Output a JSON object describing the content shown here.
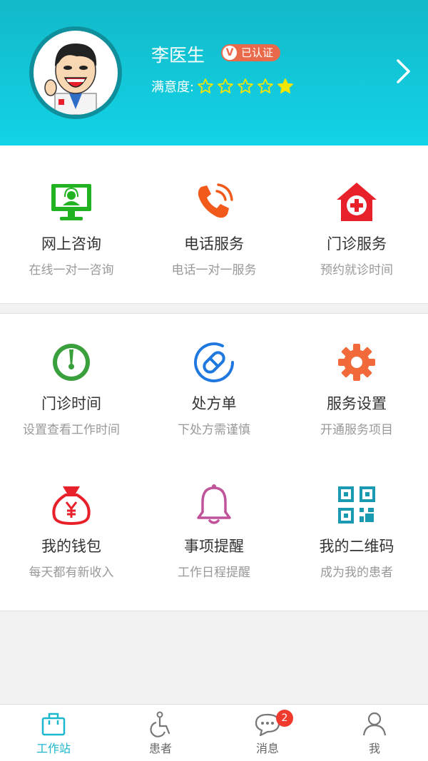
{
  "profile": {
    "name": "李医生",
    "badge_letter": "V",
    "badge_text": "已认证",
    "satisfaction_label": "满意度:",
    "rating": 1,
    "rating_max": 5
  },
  "services": [
    {
      "title": "网上咨询",
      "subtitle": "在线一对一咨询",
      "icon": "monitor-headset-icon",
      "color": "#22b322"
    },
    {
      "title": "电话服务",
      "subtitle": "电话一对一服务",
      "icon": "phone-call-icon",
      "color": "#f25a1b"
    },
    {
      "title": "门诊服务",
      "subtitle": "预约就诊时间",
      "icon": "hospital-icon",
      "color": "#e8202a"
    }
  ],
  "tools": [
    {
      "title": "门诊时间",
      "subtitle": "设置查看工作时间",
      "icon": "clock-icon",
      "color": "#3aa03d"
    },
    {
      "title": "处方单",
      "subtitle": "下处方需谨慎",
      "icon": "pill-icon",
      "color": "#1f78e0"
    },
    {
      "title": "服务设置",
      "subtitle": "开通服务项目",
      "icon": "gear-icon",
      "color": "#f26a3a"
    },
    {
      "title": "我的钱包",
      "subtitle": "每天都有新收入",
      "icon": "money-bag-icon",
      "color": "#e8202a"
    },
    {
      "title": "事项提醒",
      "subtitle": "工作日程提醒",
      "icon": "bell-icon",
      "color": "#c0539a"
    },
    {
      "title": "我的二维码",
      "subtitle": "成为我的患者",
      "icon": "qr-code-icon",
      "color": "#1a9ab0"
    }
  ],
  "tabbar": {
    "items": [
      {
        "label": "工作站",
        "icon": "briefcase-icon",
        "active": true
      },
      {
        "label": "患者",
        "icon": "wheelchair-icon",
        "active": false
      },
      {
        "label": "消息",
        "icon": "chat-bubble-icon",
        "active": false
      },
      {
        "label": "我",
        "icon": "person-icon",
        "active": false
      }
    ],
    "message_badge": "2"
  },
  "colors": {
    "header_top": "#12b9c9",
    "header_bottom": "#12d3e6",
    "accent": "#1bb7cc",
    "badge": "#e96a4a",
    "star": "#f3e600"
  }
}
